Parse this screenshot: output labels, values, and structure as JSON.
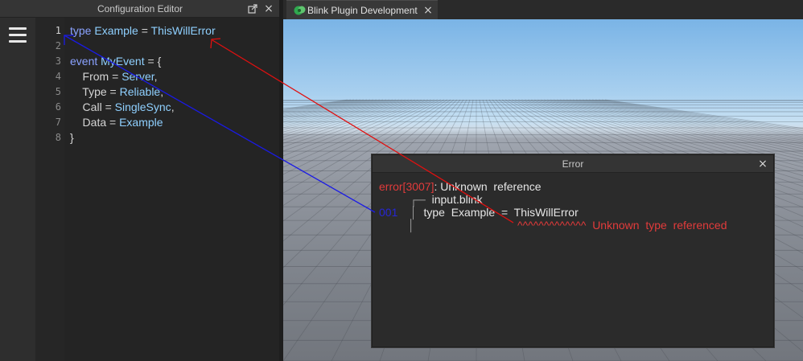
{
  "left_panel": {
    "title": "Configuration Editor",
    "close_glyph": "×",
    "popout_icon": "popout-icon",
    "menu_icon": "hamburger-menu-icon"
  },
  "editor": {
    "line_numbers": [
      "1",
      "2",
      "3",
      "4",
      "5",
      "6",
      "7",
      "8"
    ],
    "lines": [
      [
        {
          "t": "type",
          "c": "kw"
        },
        {
          "t": " ",
          "c": "pl"
        },
        {
          "t": "Example",
          "c": "ty"
        },
        {
          "t": " = ",
          "c": "pl"
        },
        {
          "t": "ThisWillError",
          "c": "ty"
        }
      ],
      [],
      [
        {
          "t": "event",
          "c": "kw"
        },
        {
          "t": " ",
          "c": "pl"
        },
        {
          "t": "MyEvent",
          "c": "ty"
        },
        {
          "t": " = {",
          "c": "pl"
        }
      ],
      [
        {
          "t": "    From = ",
          "c": "pl"
        },
        {
          "t": "Server",
          "c": "ty"
        },
        {
          "t": ",",
          "c": "pl"
        }
      ],
      [
        {
          "t": "    Type = ",
          "c": "pl"
        },
        {
          "t": "Reliable",
          "c": "ty"
        },
        {
          "t": ",",
          "c": "pl"
        }
      ],
      [
        {
          "t": "    Call = ",
          "c": "pl"
        },
        {
          "t": "SingleSync",
          "c": "ty"
        },
        {
          "t": ",",
          "c": "pl"
        }
      ],
      [
        {
          "t": "    Data = ",
          "c": "pl"
        },
        {
          "t": "Example",
          "c": "ty"
        }
      ],
      [
        {
          "t": "}",
          "c": "pl"
        }
      ]
    ]
  },
  "right_panel": {
    "tab_label": "Blink Plugin Development",
    "tab_icon": "blink-plugin-icon",
    "close_glyph": "×"
  },
  "error_dialog": {
    "title": "Error",
    "close_glyph": "×",
    "error_code": "error[3007]",
    "error_message": ": Unknown  reference",
    "file_prefix": "┌─",
    "file_name": "input.blink",
    "line_no": "001",
    "bar": "│",
    "source_text": "type  Example  =  ThisWillError",
    "carets": "^^^^^^^^^^^^^",
    "hint": "Unknown  type  referenced"
  },
  "colors": {
    "keyword": "#8aa2ff",
    "identifier": "#8fd0ff",
    "error_red": "#e23b3b",
    "line_blue": "#2626d8",
    "annotation_red": "#e01010",
    "annotation_blue": "#1a1ae6"
  }
}
